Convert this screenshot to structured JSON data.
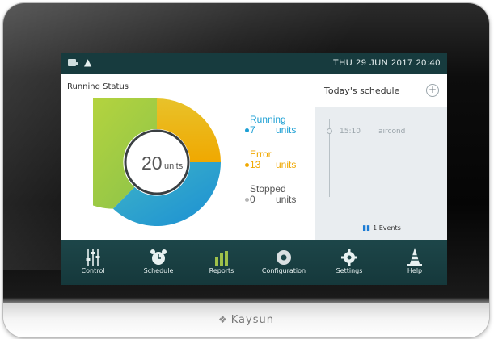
{
  "status_bar": {
    "datetime": "THU  29  JUN  2017  20:40",
    "icons": [
      "panel-icon",
      "speaker-icon"
    ]
  },
  "running_status": {
    "title": "Running Status",
    "total_value": "20",
    "total_unit": "units",
    "legend": [
      {
        "name": "Running",
        "value": "7",
        "unit": "units",
        "color": "#1b9fd4"
      },
      {
        "name": "Error",
        "value": "13",
        "unit": "units",
        "color": "#f0a800"
      },
      {
        "name": "Stopped",
        "value": "0",
        "unit": "units",
        "color": "#b5b5b5"
      }
    ]
  },
  "schedule": {
    "title": "Today's schedule",
    "add_icon": "plus-icon",
    "events": [
      {
        "time": "15:10",
        "name": "aircond"
      }
    ],
    "events_count_label": "1 Events"
  },
  "nav": [
    {
      "label": "Control",
      "icon": "sliders-icon"
    },
    {
      "label": "Schedule",
      "icon": "alarm-clock-icon"
    },
    {
      "label": "Reports",
      "icon": "bar-chart-icon"
    },
    {
      "label": "Configuration",
      "icon": "gear-circle-icon"
    },
    {
      "label": "Settings",
      "icon": "gear-icon"
    },
    {
      "label": "Help",
      "icon": "cone-icon"
    }
  ],
  "device": {
    "brand": "Kaysun"
  }
}
